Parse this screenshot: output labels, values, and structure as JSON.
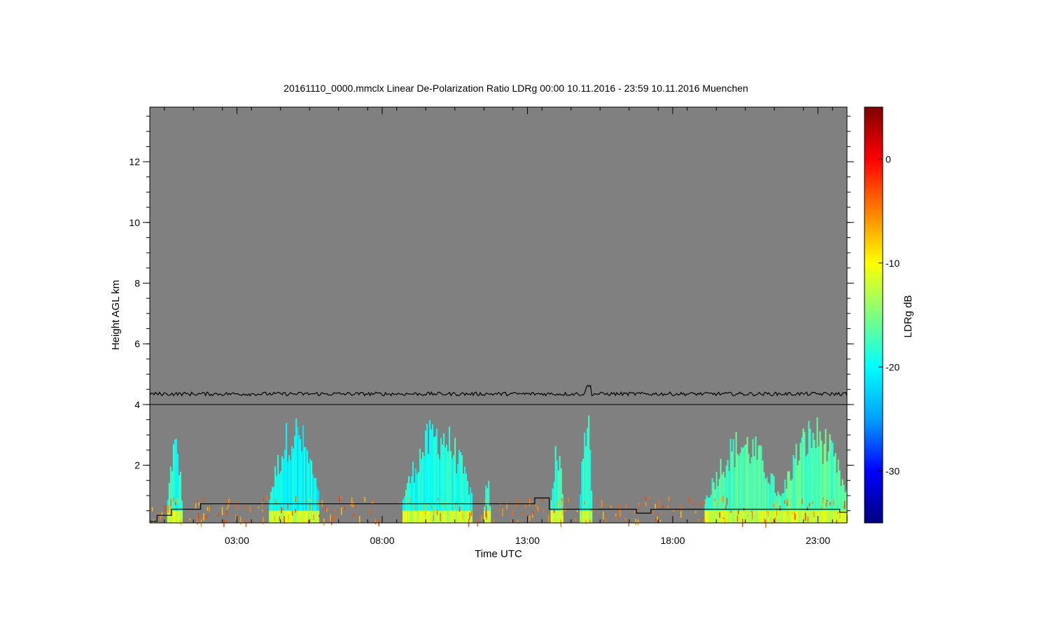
{
  "chart_data": {
    "type": "heatmap",
    "title": "20161110_0000.mmclx Linear De-Polarization Ratio LDRg   00:00 10.11.2016 - 23:59 10.11.2016 Muenchen",
    "xlabel": "Time UTC",
    "ylabel": "Height AGL km",
    "colorbar_label": "LDRg dB",
    "xlim": [
      0,
      24
    ],
    "ylim": [
      0.1,
      13.8
    ],
    "x_ticks": [
      3,
      8,
      13,
      18,
      23
    ],
    "x_tick_labels": [
      "03:00",
      "08:00",
      "13:00",
      "18:00",
      "23:00"
    ],
    "y_ticks": [
      2,
      4,
      6,
      8,
      10,
      12
    ],
    "y_tick_labels": [
      "2",
      "4",
      "6",
      "8",
      "10",
      "12"
    ],
    "colorbar_range": [
      -35,
      5
    ],
    "colorbar_ticks": [
      0,
      -10,
      -20,
      -30
    ],
    "colorbar_tick_labels": [
      "0",
      "-10",
      "-20",
      "-30"
    ],
    "colormap": [
      "#00007f",
      "#0000ff",
      "#00a0ff",
      "#00ffff",
      "#7fff7f",
      "#ffff00",
      "#ff7f00",
      "#ff0000",
      "#7f0000"
    ],
    "background_color": "#808080",
    "reference_line_height_km": 4.0,
    "noise_line_height_km": 4.35,
    "lower_line_steps": [
      {
        "x": [
          0.0,
          0.25
        ],
        "h": 0.15
      },
      {
        "x": [
          0.25,
          0.75
        ],
        "h": 0.35
      },
      {
        "x": [
          0.75,
          1.75
        ],
        "h": 0.55
      },
      {
        "x": [
          1.75,
          13.25
        ],
        "h": 0.73
      },
      {
        "x": [
          13.25,
          13.75
        ],
        "h": 0.92
      },
      {
        "x": [
          13.75,
          16.75
        ],
        "h": 0.55
      },
      {
        "x": [
          16.75,
          17.25
        ],
        "h": 0.42
      },
      {
        "x": [
          17.25,
          23.75
        ],
        "h": 0.55
      },
      {
        "x": [
          23.75,
          24.0
        ],
        "h": 0.45
      }
    ],
    "cloud_columns": [
      {
        "x": [
          0.6,
          1.1
        ],
        "top": 3.2,
        "ldr": -19
      },
      {
        "x": [
          4.1,
          5.8
        ],
        "top": 3.8,
        "ldr": -20
      },
      {
        "x": [
          8.7,
          11.1
        ],
        "top": 3.7,
        "ldr": -19
      },
      {
        "x": [
          11.5,
          11.7
        ],
        "top": 1.8,
        "ldr": -18
      },
      {
        "x": [
          13.8,
          14.2
        ],
        "top": 3.0,
        "ldr": -18
      },
      {
        "x": [
          14.8,
          15.2
        ],
        "top": 4.4,
        "ldr": -19
      },
      {
        "x": [
          19.1,
          21.7
        ],
        "top": 3.3,
        "ldr": -17
      },
      {
        "x": [
          21.7,
          24.0
        ],
        "top": 3.7,
        "ldr": -17
      }
    ],
    "near_surface_ldr": -12,
    "grid": false,
    "legend": "colorbar right"
  }
}
